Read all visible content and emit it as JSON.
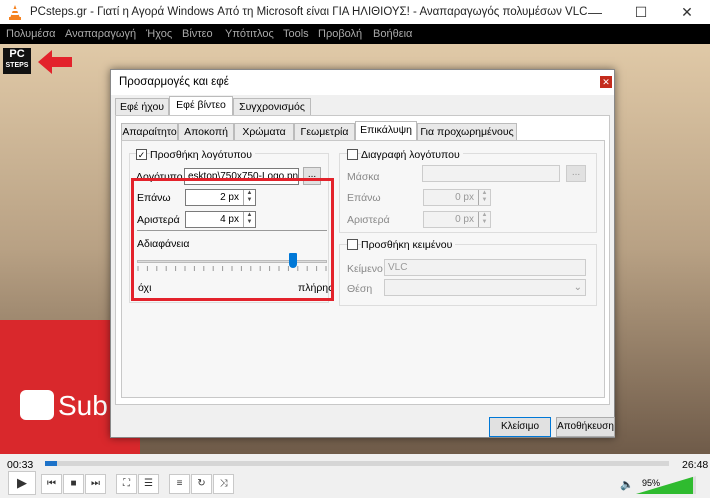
{
  "window": {
    "title": "PCsteps.gr - Γιατί η Αγορά Windows Από τη Microsoft είναι ΓΙΑ ΗΛΙΘΙΟΥΣ! - Αναπαραγωγός πολυμέσων VLC",
    "min": "—",
    "max": "☐",
    "close": "✕"
  },
  "menu": [
    "Πολυμέσα",
    "Αναπαραγωγή",
    "Ήχος",
    "Βίντεο",
    "Υπότιτλος",
    "Tools",
    "Προβολή",
    "Βοήθεια"
  ],
  "overlay": {
    "logo_line1": "PC",
    "logo_line2": "STEPS",
    "subscribe": "Sub"
  },
  "dialog": {
    "title": "Προσαρμογές και εφέ",
    "close": "✕",
    "tabs": [
      "Εφέ ήχου",
      "Εφέ βίντεο",
      "Συγχρονισμός"
    ],
    "subtabs": [
      "Απαραίτητο",
      "Αποκοπή",
      "Χρώματα",
      "Γεωμετρία",
      "Επικάλυψη",
      "Για προχωρημένους"
    ],
    "logo": {
      "enable_label": "Προσθήκη λογότυπου",
      "checked": "✓",
      "file_label": "Λογότυπο",
      "file_value": "esktop\\750x750-Logo.png",
      "browse": "...",
      "top_label": "Επάνω",
      "top_value": "2 px",
      "left_label": "Αριστερά",
      "left_value": "4 px",
      "opacity_label": "Αδιαφάνεια",
      "min_label": "όχι",
      "max_label": "πλήρης",
      "opacity": 0.82
    },
    "mask": {
      "enable_label": "Διαγραφή λογότυπου",
      "mask_label": "Μάσκα",
      "browse": "...",
      "top_label": "Επάνω",
      "top_value": "0 px",
      "left_label": "Αριστερά",
      "left_value": "0 px"
    },
    "text": {
      "enable_label": "Προσθήκη κειμένου",
      "text_label": "Κείμενο",
      "text_value": "VLC",
      "pos_label": "Θέση"
    },
    "close_btn": "Κλείσιμο",
    "save_btn": "Αποθήκευση"
  },
  "player": {
    "elapsed": "00:33",
    "total": "26:48",
    "volume": "95%",
    "progress": 0.02,
    "volume_level": 0.95
  },
  "colors": {
    "highlight": "#e3222b",
    "accent": "#0078d7"
  }
}
